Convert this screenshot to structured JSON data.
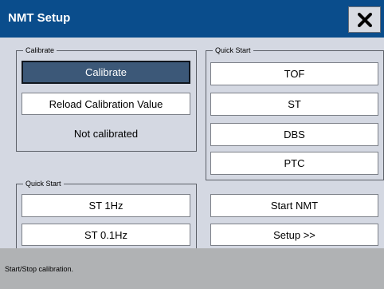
{
  "window": {
    "title": "NMT Setup",
    "close_icon": "close-icon"
  },
  "calibrate_group": {
    "label": "Calibrate",
    "calibrate_button": "Calibrate",
    "reload_button": "Reload Calibration Value",
    "status": "Not calibrated"
  },
  "quick_start_right": {
    "label": "Quick Start",
    "buttons": [
      "TOF",
      "ST",
      "DBS",
      "PTC"
    ]
  },
  "quick_start_left": {
    "label": "Quick Start",
    "buttons": [
      "ST 1Hz",
      "ST 0.1Hz"
    ]
  },
  "actions": {
    "start_nmt": "Start NMT",
    "setup": "Setup >>"
  },
  "status_bar": {
    "message": "Start/Stop calibration."
  },
  "colors": {
    "titlebar": "#0a4d8c",
    "panel": "#d4d8e2",
    "selected_button": "#3c5878",
    "status_bar": "#b0b2b4"
  }
}
